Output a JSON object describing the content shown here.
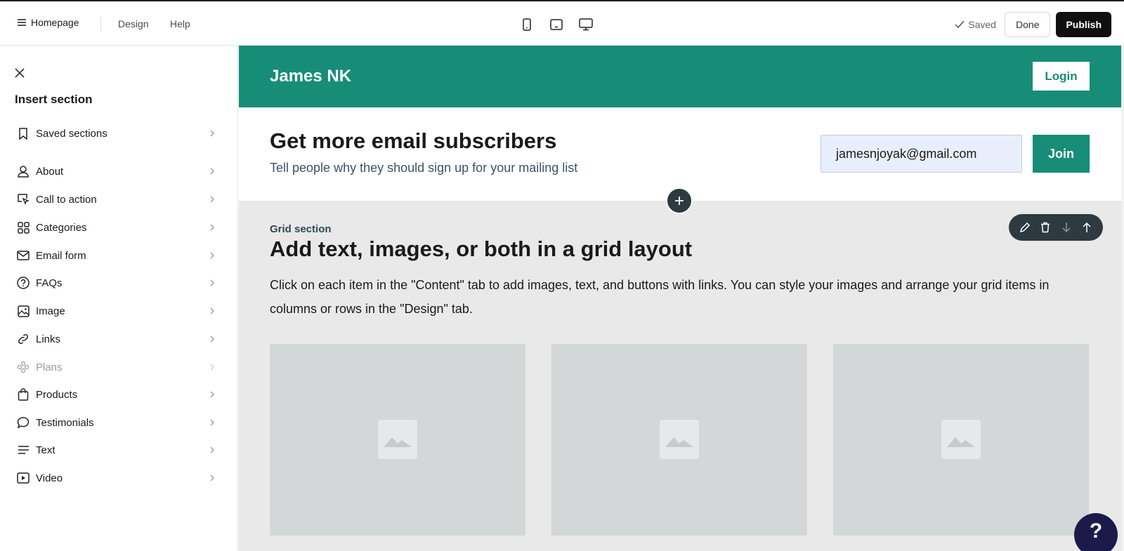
{
  "topbar": {
    "page_name": "Homepage",
    "nav": [
      "Design",
      "Help"
    ],
    "devices": [
      "mobile-icon",
      "tablet-icon",
      "desktop-icon"
    ],
    "saved_label": "Saved",
    "done_label": "Done",
    "publish_label": "Publish"
  },
  "sidebar": {
    "title": "Insert section",
    "items": [
      {
        "label": "Saved sections",
        "icon": "bookmark-icon",
        "disabled": false
      },
      {
        "label": "About",
        "icon": "person-icon",
        "disabled": false
      },
      {
        "label": "Call to action",
        "icon": "cursor-click-icon",
        "disabled": false
      },
      {
        "label": "Categories",
        "icon": "grid-icon",
        "disabled": false
      },
      {
        "label": "Email form",
        "icon": "envelope-icon",
        "disabled": false
      },
      {
        "label": "FAQs",
        "icon": "question-icon",
        "disabled": false
      },
      {
        "label": "Image",
        "icon": "image-icon",
        "disabled": false
      },
      {
        "label": "Links",
        "icon": "link-icon",
        "disabled": false
      },
      {
        "label": "Plans",
        "icon": "plans-icon",
        "disabled": true
      },
      {
        "label": "Products",
        "icon": "shopping-bag-icon",
        "disabled": false
      },
      {
        "label": "Testimonials",
        "icon": "speech-bubble-icon",
        "disabled": false
      },
      {
        "label": "Text",
        "icon": "text-lines-icon",
        "disabled": false
      },
      {
        "label": "Video",
        "icon": "video-play-icon",
        "disabled": false
      }
    ]
  },
  "site": {
    "name": "James NK",
    "login_label": "Login"
  },
  "email_section": {
    "heading": "Get more email subscribers",
    "subtext": "Tell people why they should sign up for your mailing list",
    "email_value": "jamesnjoyak@gmail.com",
    "join_label": "Join"
  },
  "grid_section": {
    "label": "Grid section",
    "heading": "Add text, images, or both in a grid layout",
    "body": "Click on each item in the \"Content\" tab to add images, text, and buttons with links. You can style your images and arrange your grid items in columns or rows in the \"Design\" tab.",
    "tiles": 3
  },
  "help_label": "?",
  "colors": {
    "brand": "#178d78",
    "dark": "#0f0f0f",
    "fab": "#2d3a3f",
    "help": "#1c1a4a"
  }
}
